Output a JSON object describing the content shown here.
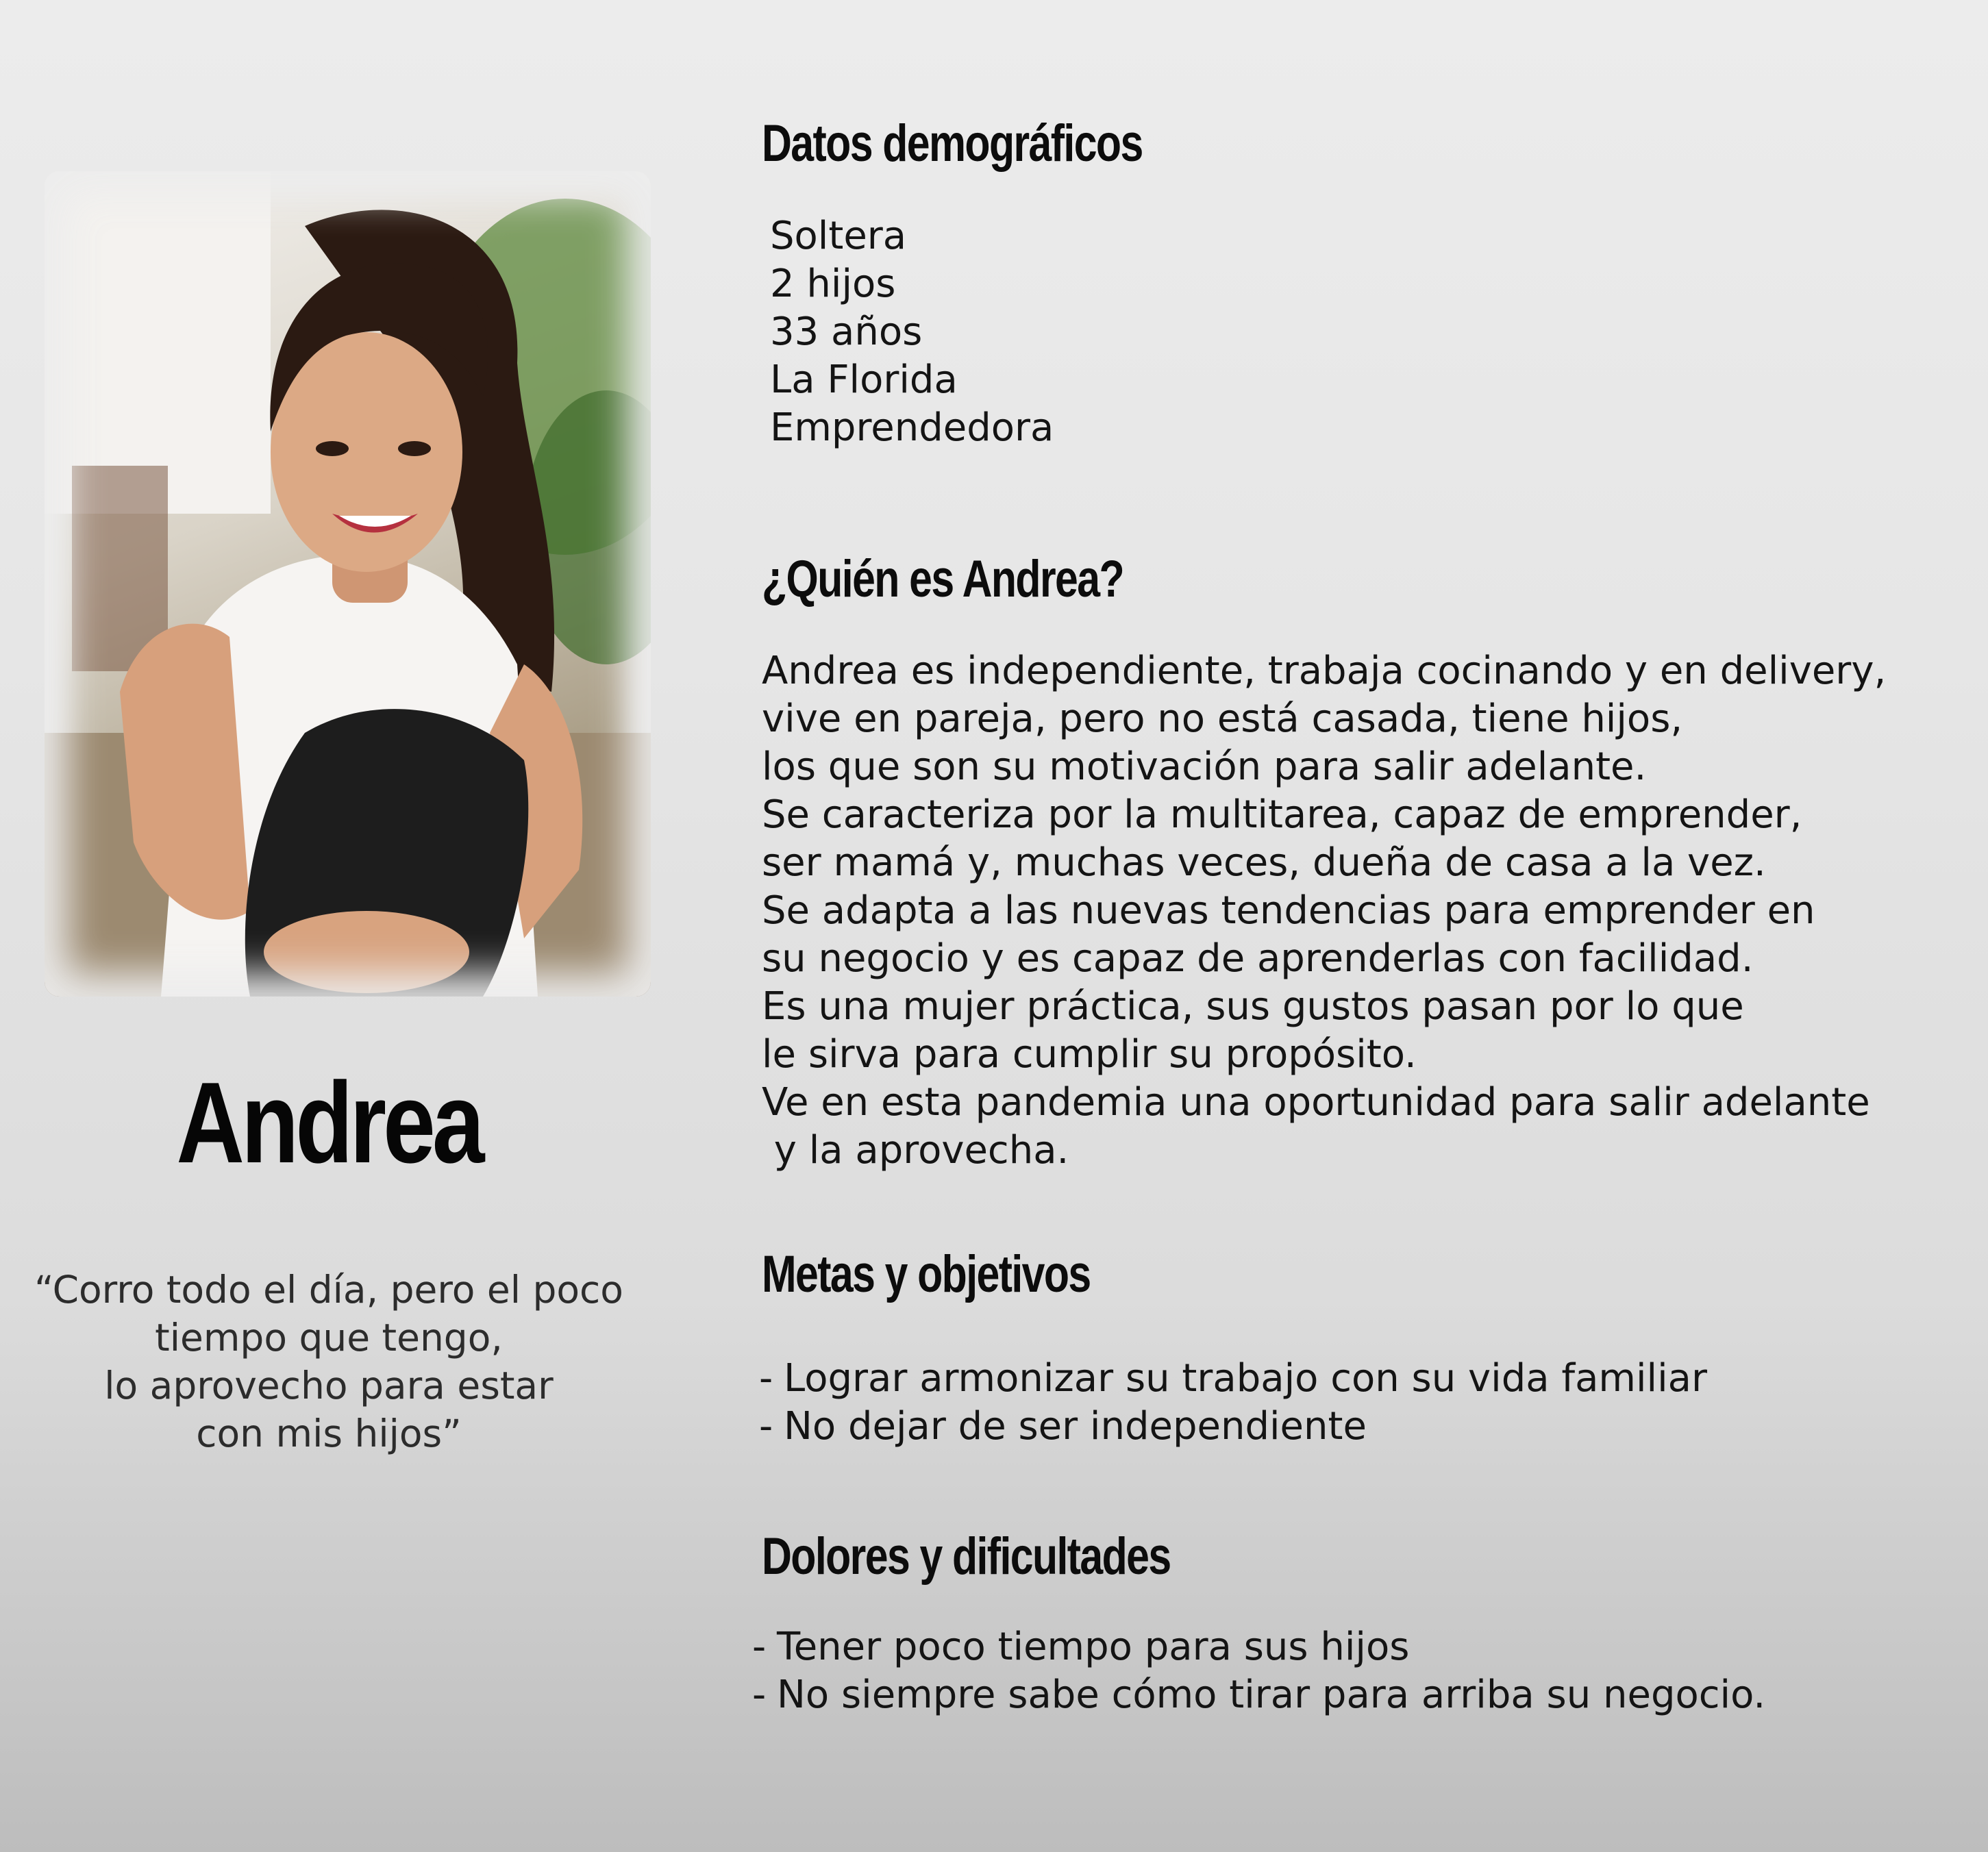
{
  "persona": {
    "name": "Andrea",
    "quote_lines": [
      "“Corro todo el día, pero el poco",
      "tiempo que tengo,",
      "lo aprovecho para estar",
      "con mis hijos”"
    ]
  },
  "demographics": {
    "heading": "Datos demográficos",
    "items": [
      "Soltera",
      "2 hijos",
      "33 años",
      "La Florida",
      "Emprendedora"
    ]
  },
  "who": {
    "heading": "¿Quién es Andrea?",
    "lines": [
      "Andrea es independiente, trabaja cocinando y en delivery,",
      "vive en pareja, pero no está casada, tiene hijos,",
      "los que son su motivación para salir adelante.",
      "Se caracteriza por la multitarea, capaz de emprender,",
      "ser mamá y, muchas veces, dueña de casa a la vez.",
      "Se adapta a las nuevas tendencias para emprender en",
      "su negocio y es capaz de aprenderlas con facilidad.",
      "Es una mujer práctica, sus gustos pasan por lo que",
      "le sirva para cumplir su propósito.",
      "Ve en esta pandemia una oportunidad para salir adelante",
      " y la aprovecha."
    ]
  },
  "goals": {
    "heading": "Metas y objetivos",
    "items": [
      "Lograr armonizar su trabajo con su vida familiar",
      "No dejar de ser independiente"
    ]
  },
  "pains": {
    "heading": "Dolores y dificultades",
    "items": [
      "Tener poco tiempo para sus hijos",
      "No siempre sabe cómo tirar para arriba su negocio."
    ]
  },
  "bullet_marker": "-"
}
